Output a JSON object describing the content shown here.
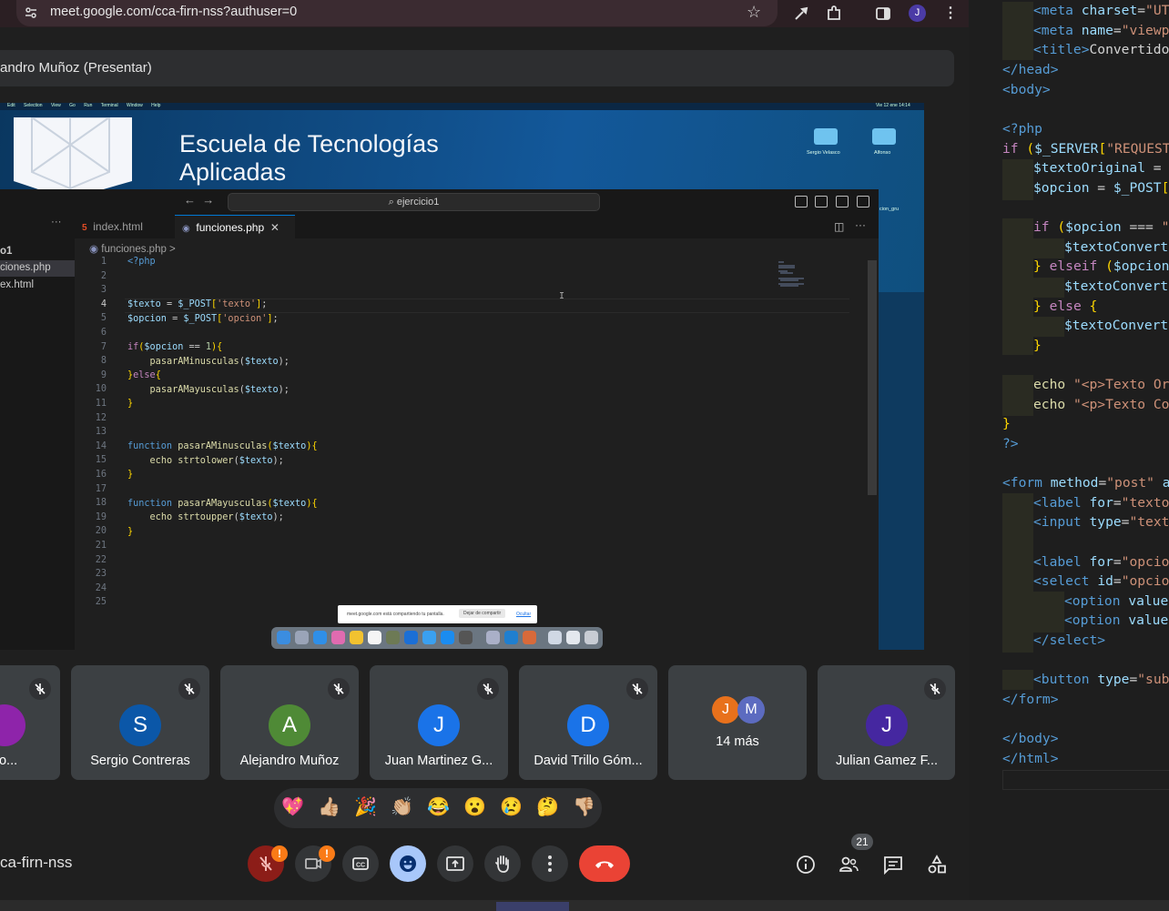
{
  "browser": {
    "url": "meet.google.com/cca-firn-nss?authuser=0",
    "profile_initial": "J"
  },
  "presenter_label": "andro Muñoz (Presentar)",
  "shared_screen": {
    "menubar": [
      "Edit",
      "Selection",
      "View",
      "Go",
      "Run",
      "Terminal",
      "Window",
      "Help"
    ],
    "menubar_time": "Vie 12 ene 14:14",
    "school_line1": "Escuela de Tecnologías",
    "school_line2": "Aplicadas",
    "desktop_folders": [
      {
        "label": "Sergio Velasco"
      },
      {
        "label": "Alfonso"
      }
    ],
    "desktop_partial_label": "cion_gru",
    "vscode": {
      "search": "ejercicio1",
      "sidebar": [
        "o1",
        "ciones.php",
        "ex.html"
      ],
      "tabs": [
        {
          "label": "index.html",
          "active": false
        },
        {
          "label": "funciones.php",
          "active": true
        }
      ],
      "breadcrumb": "funciones.php >",
      "line_numbers": [
        "1",
        "2",
        "3",
        "4",
        "5",
        "6",
        "7",
        "8",
        "9",
        "10",
        "11",
        "12",
        "13",
        "14",
        "15",
        "16",
        "17",
        "18",
        "19",
        "20",
        "21",
        "22",
        "23",
        "24",
        "25"
      ],
      "current_line": "4"
    },
    "share_notice": {
      "text": "meet.google.com está compartiendo tu pantalla.",
      "stop": "Dejar de compartir",
      "hide": "Ocultar"
    }
  },
  "participants": [
    {
      "name": "el Bo...",
      "initial": "",
      "color": "#8e24aa"
    },
    {
      "name": "Sergio Contreras",
      "initial": "S",
      "color": "#0b57a8"
    },
    {
      "name": "Alejandro Muñoz",
      "initial": "A",
      "color": "#4f8a36"
    },
    {
      "name": "Juan Martinez G...",
      "initial": "J",
      "color": "#1a73e8"
    },
    {
      "name": "David Trillo Góm...",
      "initial": "D",
      "color": "#1a73e8"
    },
    {
      "name": "14 más",
      "initial": "",
      "color": ""
    },
    {
      "name": "Julian Gamez F...",
      "initial": "J",
      "color": "#4527a0"
    }
  ],
  "more_tile": {
    "initials": [
      "J",
      "M"
    ],
    "colors": [
      "#e8711c",
      "#5c6bc0"
    ]
  },
  "reactions": [
    "💖",
    "👍🏼",
    "🎉",
    "👏🏼",
    "😂",
    "😮",
    "😢",
    "🤔",
    "👎🏼"
  ],
  "meeting_code": "ca-firn-nss",
  "participant_count": "21",
  "badges": [
    "!",
    "!"
  ],
  "icons": {
    "mic": "mic-off-icon",
    "camera": "camera-off-icon",
    "captions": "captions-icon",
    "emoji": "emoji-icon",
    "present": "present-screen-icon",
    "hand": "raise-hand-icon",
    "more": "more-options-icon",
    "leave": "leave-call-icon",
    "info": "info-icon",
    "people": "people-icon",
    "chat": "chat-icon",
    "activities": "activities-icon"
  },
  "accent_colors": {
    "leave": "#ea4335",
    "emoji_active": "#a8c7fa",
    "mic_off": "#8c1d18",
    "badge": "#fa7b17"
  }
}
